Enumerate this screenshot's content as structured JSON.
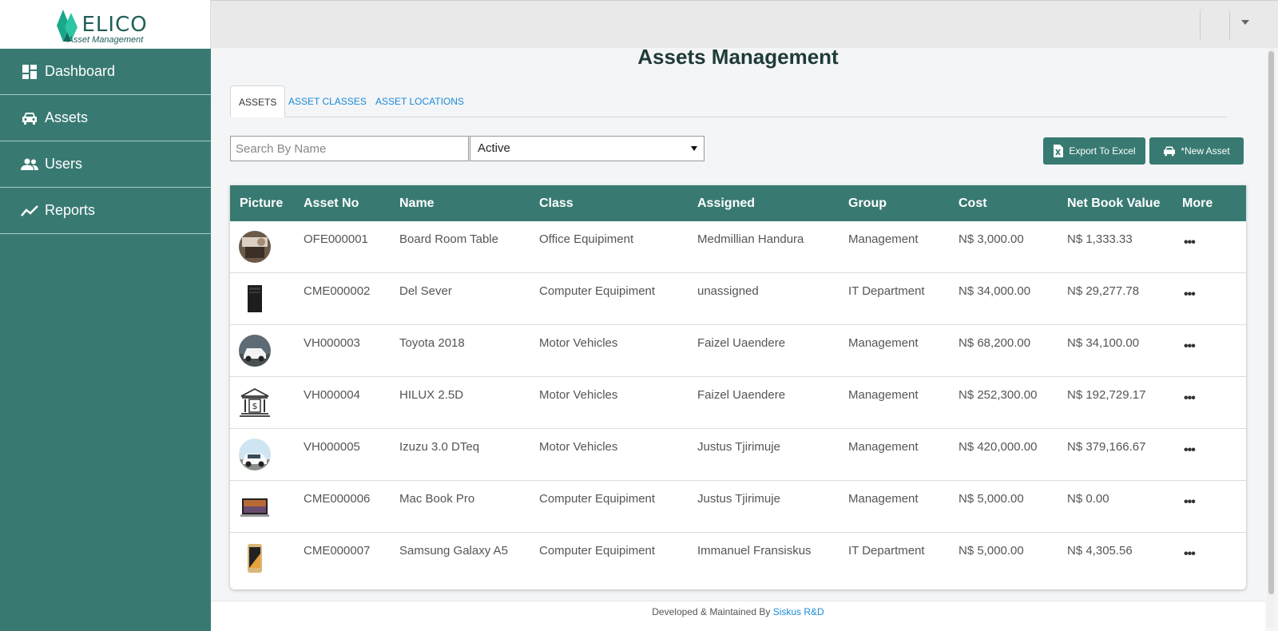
{
  "brand": {
    "name": "ELICO",
    "subtitle": "Asset  Management"
  },
  "sidebar": {
    "items": [
      {
        "label": "Dashboard",
        "icon": "dashboard-icon"
      },
      {
        "label": "Assets",
        "icon": "car-icon"
      },
      {
        "label": "Users",
        "icon": "users-icon"
      },
      {
        "label": "Reports",
        "icon": "trend-line-icon"
      }
    ]
  },
  "page": {
    "title": "Assets Management"
  },
  "tabs": [
    {
      "label": "ASSETS",
      "active": true
    },
    {
      "label": "ASSET CLASSES",
      "active": false
    },
    {
      "label": "ASSET LOCATIONS",
      "active": false
    }
  ],
  "filters": {
    "search_placeholder": "Search By Name",
    "status_value": "Active"
  },
  "buttons": {
    "export": "Export To Excel",
    "new_asset": "*New Asset"
  },
  "table": {
    "headers": [
      "Picture",
      "Asset No",
      "Name",
      "Class",
      "Assigned",
      "Group",
      "Cost",
      "Net Book Value",
      "More"
    ],
    "rows": [
      {
        "pic": "table-photo",
        "asset_no": "OFE000001",
        "name": "Board Room Table",
        "class": "Office Equipiment",
        "assigned": "Medmillian Handura",
        "group": "Management",
        "cost": "N$ 3,000.00",
        "nbv": "N$ 1,333.33",
        "more": "•••"
      },
      {
        "pic": "server-photo",
        "asset_no": "CME000002",
        "name": "Del Sever",
        "class": "Computer Equipiment",
        "assigned": "unassigned",
        "group": "IT Department",
        "cost": "N$ 34,000.00",
        "nbv": "N$ 29,277.78",
        "more": "•••"
      },
      {
        "pic": "vehicle-photo",
        "asset_no": "VH000003",
        "name": "Toyota 2018",
        "class": "Motor Vehicles",
        "assigned": "Faizel Uaendere",
        "group": "Management",
        "cost": "N$ 68,200.00",
        "nbv": "N$ 34,100.00",
        "more": "•••"
      },
      {
        "pic": "bank-icon",
        "asset_no": "VH000004",
        "name": "HILUX 2.5D",
        "class": "Motor Vehicles",
        "assigned": "Faizel Uaendere",
        "group": "Management",
        "cost": "N$ 252,300.00",
        "nbv": "N$ 192,729.17",
        "more": "•••"
      },
      {
        "pic": "vehicle-photo",
        "asset_no": "VH000005",
        "name": "Izuzu 3.0 DTeq",
        "class": "Motor Vehicles",
        "assigned": "Justus Tjirimuje",
        "group": "Management",
        "cost": "N$ 420,000.00",
        "nbv": "N$ 379,166.67",
        "more": "•••"
      },
      {
        "pic": "laptop-photo",
        "asset_no": "CME000006",
        "name": "Mac Book Pro",
        "class": "Computer Equipiment",
        "assigned": "Justus Tjirimuje",
        "group": "Management",
        "cost": "N$ 5,000.00",
        "nbv": "N$ 0.00",
        "more": "•••"
      },
      {
        "pic": "phone-photo",
        "asset_no": "CME000007",
        "name": "Samsung Galaxy A5",
        "class": "Computer Equipiment",
        "assigned": "Immanuel Fransiskus",
        "group": "IT Department",
        "cost": "N$ 5,000.00",
        "nbv": "N$ 4,305.56",
        "more": "•••"
      }
    ]
  },
  "footer": {
    "text": "Developed & Maintained By ",
    "link": "Siskus R&D"
  },
  "colors": {
    "primary": "#387a72",
    "link": "#1a8ad6",
    "title": "#1f3b38"
  }
}
